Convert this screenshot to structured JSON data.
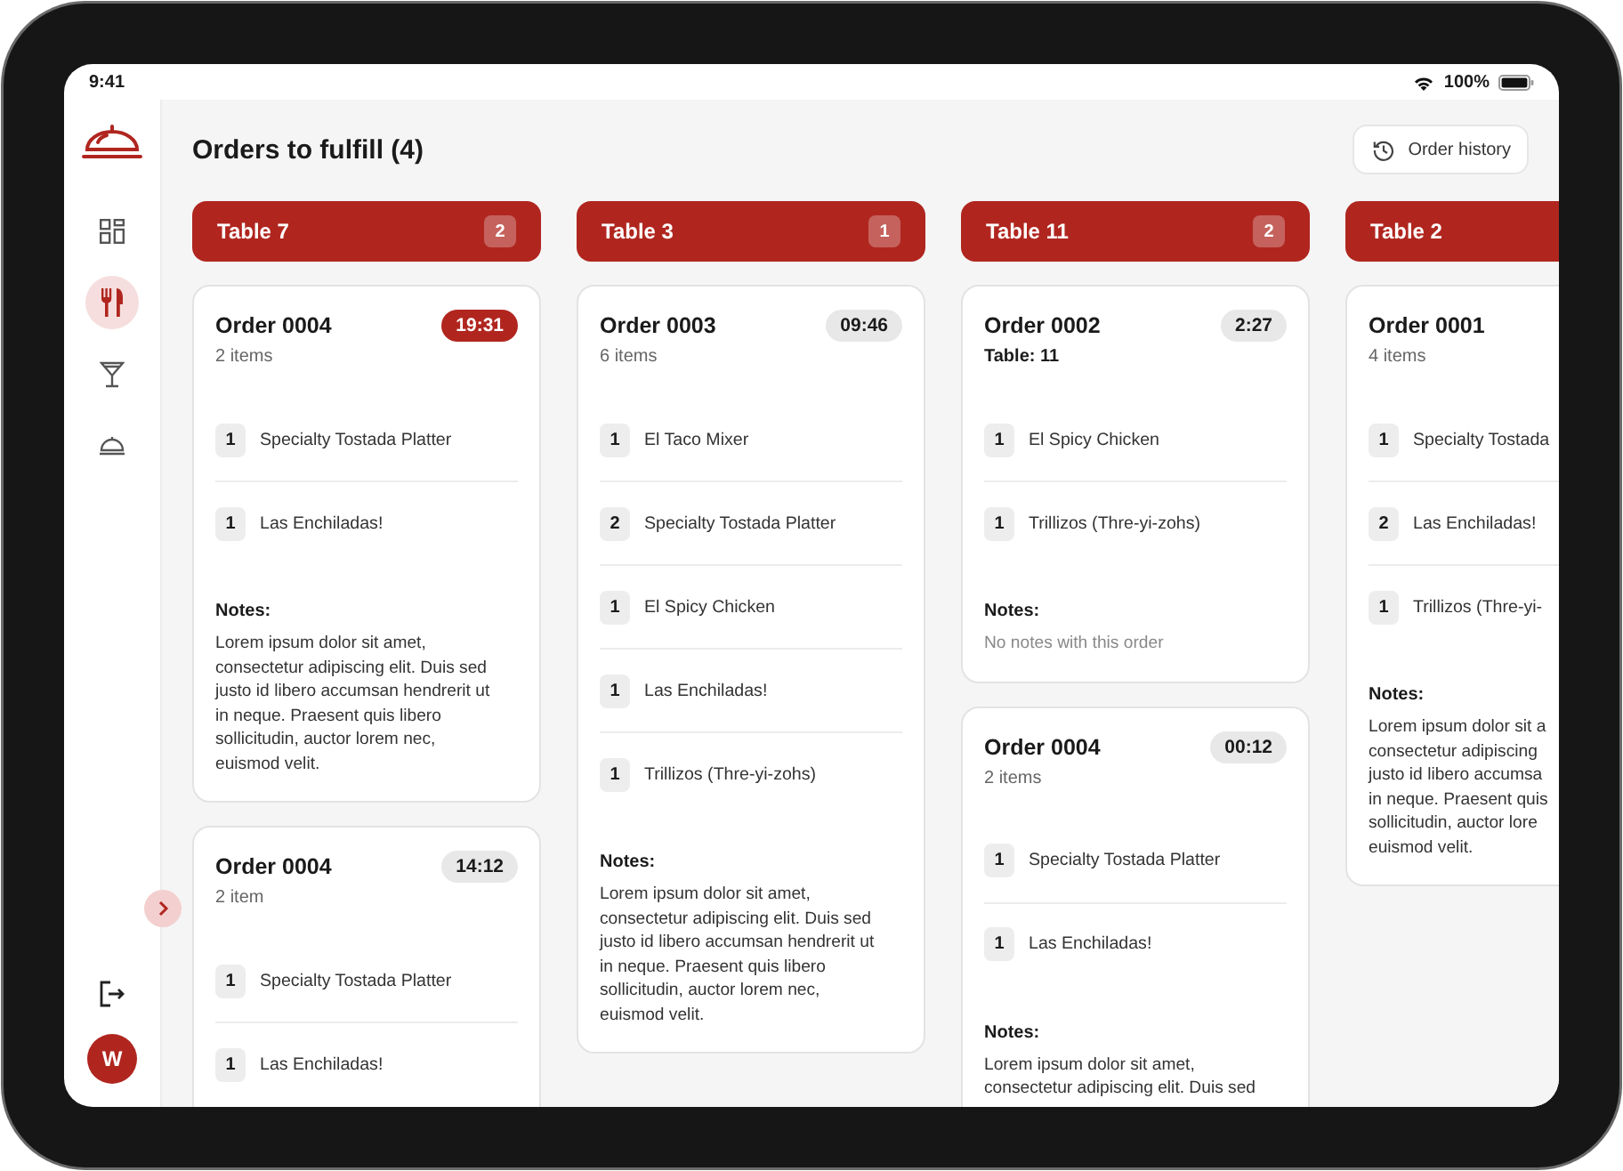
{
  "status_bar": {
    "time": "9:41",
    "battery": "100%"
  },
  "sidebar": {
    "items": [
      {
        "kind": "dashboard",
        "selected": false
      },
      {
        "kind": "utensils",
        "selected": true
      },
      {
        "kind": "cocktail",
        "selected": false
      },
      {
        "kind": "cloche",
        "selected": false
      }
    ],
    "avatar": "W"
  },
  "header": {
    "title": "Orders to fulfill (4)",
    "history_button": "Order history"
  },
  "columns": [
    {
      "table": "Table 7",
      "count": "2",
      "orders": [
        {
          "title": "Order 0004",
          "subtitle": "2 items",
          "subtitle_strong": false,
          "timer": "19:31",
          "urgent": true,
          "items": [
            {
              "qty": "1",
              "name": "Specialty Tostada Platter"
            },
            {
              "qty": "1",
              "name": "Las Enchiladas!"
            }
          ],
          "notes_label": "Notes:",
          "notes_empty": false,
          "notes": [
            "Lorem ipsum dolor sit amet,",
            "consectetur adipiscing elit. Duis sed",
            "justo id libero accumsan hendrerit ut",
            "in neque. Praesent quis libero",
            "sollicitudin, auctor lorem nec,",
            "euismod velit."
          ]
        },
        {
          "title": "Order 0004",
          "subtitle": "2 item",
          "subtitle_strong": false,
          "timer": "14:12",
          "urgent": false,
          "items": [
            {
              "qty": "1",
              "name": "Specialty Tostada Platter"
            },
            {
              "qty": "1",
              "name": "Las Enchiladas!"
            }
          ]
        }
      ]
    },
    {
      "table": "Table 3",
      "count": "1",
      "orders": [
        {
          "title": "Order 0003",
          "subtitle": "6 items",
          "subtitle_strong": false,
          "timer": "09:46",
          "urgent": false,
          "items": [
            {
              "qty": "1",
              "name": "El Taco Mixer"
            },
            {
              "qty": "2",
              "name": "Specialty Tostada Platter"
            },
            {
              "qty": "1",
              "name": "El Spicy Chicken"
            },
            {
              "qty": "1",
              "name": "Las Enchiladas!"
            },
            {
              "qty": "1",
              "name": "Trillizos (Thre-yi-zohs)"
            }
          ],
          "notes_label": "Notes:",
          "notes_empty": false,
          "notes": [
            "Lorem ipsum dolor sit amet,",
            "consectetur adipiscing elit. Duis sed",
            "justo id libero accumsan hendrerit ut",
            "in neque. Praesent quis libero",
            "sollicitudin, auctor lorem nec,",
            "euismod velit."
          ]
        }
      ]
    },
    {
      "table": "Table 11",
      "count": "2",
      "orders": [
        {
          "title": "Order 0002",
          "subtitle": "Table: 11",
          "subtitle_strong": true,
          "timer": "2:27",
          "urgent": false,
          "items": [
            {
              "qty": "1",
              "name": "El Spicy Chicken"
            },
            {
              "qty": "1",
              "name": "Trillizos (Thre-yi-zohs)"
            }
          ],
          "notes_label": "Notes:",
          "notes_empty": true,
          "notes": [
            "No notes with this order"
          ]
        },
        {
          "title": "Order 0004",
          "subtitle": "2 items",
          "subtitle_strong": false,
          "timer": "00:12",
          "urgent": false,
          "items": [
            {
              "qty": "1",
              "name": "Specialty Tostada Platter"
            },
            {
              "qty": "1",
              "name": "Las Enchiladas!"
            }
          ],
          "notes_label": "Notes:",
          "notes_empty": false,
          "notes": [
            "Lorem ipsum dolor sit amet,",
            "consectetur adipiscing elit. Duis sed"
          ]
        }
      ]
    },
    {
      "table": "Table 2",
      "orders": [
        {
          "title": "Order 0001",
          "subtitle": "4 items",
          "subtitle_strong": false,
          "items": [
            {
              "qty": "1",
              "name": "Specialty Tostada"
            },
            {
              "qty": "2",
              "name": "Las Enchiladas!"
            },
            {
              "qty": "1",
              "name": "Trillizos (Thre-yi-"
            }
          ],
          "notes_label": "Notes:",
          "notes_empty": false,
          "notes": [
            "Lorem ipsum dolor sit a",
            "consectetur adipiscing",
            "justo id libero accumsa",
            "in neque. Praesent quis",
            "sollicitudin, auctor lore",
            "euismod velit."
          ]
        }
      ]
    }
  ]
}
